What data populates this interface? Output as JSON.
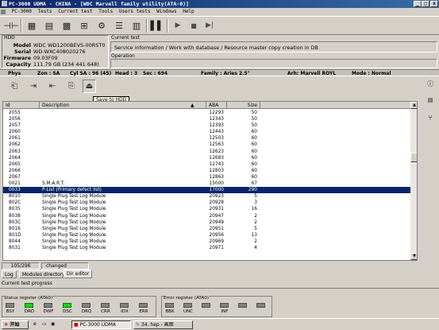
{
  "window": {
    "title": "PC-3000 UDMA - CHINA - [WDC Marvell family utility(ATA-0)]",
    "min": "_",
    "max": "□",
    "close": "x"
  },
  "menu": [
    "PC-3000",
    "Tests",
    "Current test",
    "Tools",
    "Users tests",
    "Windows",
    "Help"
  ],
  "hdd": {
    "section_label": "HDD",
    "model_label": "Model",
    "model": "WDC WD1200BEVS-00RST0",
    "serial_label": "Serial",
    "serial": "WD-WXC408020276",
    "firmware_label": "Firmware",
    "firmware": "09.03F09",
    "capacity_label": "Capacity",
    "capacity": "111.79 GB (234 441 648)"
  },
  "current_test": {
    "label": "Current test",
    "value": "Service information / Work with database / Resource master copy creation in DB",
    "operation_label": "Operation"
  },
  "status_line": {
    "phys": "Phys",
    "zone": "Zon : SA",
    "cyl": "Cyl SA : 96 (45)",
    "head": "Head : 3",
    "sec": "Sec : 694",
    "family": "Family : Aries 2.5\"",
    "arh": "Arh: Marvell ROYL",
    "mode": "Mode : Normal"
  },
  "tooltip": "Save to HDD",
  "table": {
    "headers": {
      "id": "Id",
      "description": "Description",
      "aba": "ABA",
      "size": "Size"
    },
    "rows": [
      {
        "id": "2055",
        "desc": "",
        "aba": "12293",
        "size": "50"
      },
      {
        "id": "2056",
        "desc": "",
        "aba": "12343",
        "size": "50"
      },
      {
        "id": "2057",
        "desc": "",
        "aba": "12393",
        "size": "50"
      },
      {
        "id": "2060",
        "desc": "",
        "aba": "12443",
        "size": "60"
      },
      {
        "id": "2061",
        "desc": "",
        "aba": "12503",
        "size": "60"
      },
      {
        "id": "2062",
        "desc": "",
        "aba": "12563",
        "size": "60"
      },
      {
        "id": "2063",
        "desc": "",
        "aba": "12623",
        "size": "60"
      },
      {
        "id": "2064",
        "desc": "",
        "aba": "12683",
        "size": "60"
      },
      {
        "id": "2065",
        "desc": "",
        "aba": "12743",
        "size": "60"
      },
      {
        "id": "2066",
        "desc": "",
        "aba": "12803",
        "size": "60"
      },
      {
        "id": "2067",
        "desc": "",
        "aba": "12863",
        "size": "60"
      },
      {
        "id": "0021",
        "desc": "S.M.A.R.T.",
        "aba": "15000",
        "size": "67"
      },
      {
        "id": "0033",
        "desc": "P-List (Primary defect list)",
        "aba": "17000",
        "size": "290",
        "selected": true
      },
      {
        "id": "8010",
        "desc": "Single Plug Test Log Module",
        "aba": "20923",
        "size": "5"
      },
      {
        "id": "802C",
        "desc": "Single Plug Test Log Module",
        "aba": "20928",
        "size": "3"
      },
      {
        "id": "8035",
        "desc": "Single Plug Test Log Module",
        "aba": "20931",
        "size": "16"
      },
      {
        "id": "8038",
        "desc": "Single Plug Test Log Module",
        "aba": "20947",
        "size": "2"
      },
      {
        "id": "803C",
        "desc": "Single Plug Test Log Module",
        "aba": "20949",
        "size": "2"
      },
      {
        "id": "8016",
        "desc": "Single Plug Test Log Module",
        "aba": "20951",
        "size": "5"
      },
      {
        "id": "801D",
        "desc": "Single Plug Test Log Module",
        "aba": "20956",
        "size": "13"
      },
      {
        "id": "8044",
        "desc": "Single Plug Test Log Module",
        "aba": "20969",
        "size": "2"
      },
      {
        "id": "8031",
        "desc": "Single Plug Test Log Module",
        "aba": "20971",
        "size": "4"
      }
    ]
  },
  "counter": {
    "position": "105/296",
    "state": "changed"
  },
  "tabs": [
    "Log",
    "Modules directory",
    "Dir editor"
  ],
  "progress_label": "Current test progress",
  "status_register": {
    "label": "Status register (ATA0)",
    "leds": [
      {
        "name": "BSY",
        "on": false
      },
      {
        "name": "DRD",
        "on": true
      },
      {
        "name": "DWF",
        "on": false
      },
      {
        "name": "DSC",
        "on": true
      },
      {
        "name": "DRQ",
        "on": false
      },
      {
        "name": "CRR",
        "on": false
      },
      {
        "name": "IDX",
        "on": false
      },
      {
        "name": "ERR",
        "on": false
      }
    ]
  },
  "error_register": {
    "label": "Error register (ATA0)",
    "leds": [
      {
        "name": "BBK",
        "on": false
      },
      {
        "name": "UNC",
        "on": false
      },
      {
        "name": "",
        "on": false
      },
      {
        "name": "INF",
        "on": false
      },
      {
        "name": "",
        "on": false
      },
      {
        "name": "",
        "on": false
      }
    ]
  },
  "taskbar": {
    "start": "开始",
    "tasks": [
      "PC-3000 UDMA",
      "34. hep - 画图"
    ]
  },
  "colors": {
    "titlebar": "#0a246a",
    "selection": "#0a246a",
    "led_on": "#1ad41a",
    "led_off": "#808080"
  }
}
